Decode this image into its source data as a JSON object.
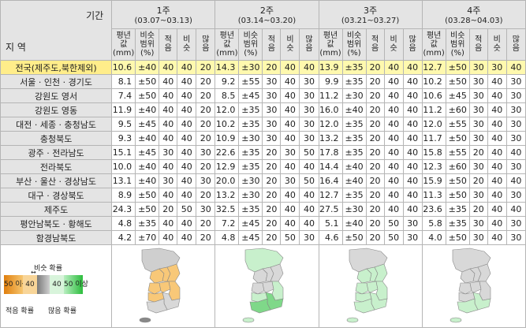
{
  "header": {
    "region_label": "지 역",
    "period_label": "기간"
  },
  "weeks": [
    {
      "title": "1주",
      "dates": "(03.07~03.13)"
    },
    {
      "title": "2주",
      "dates": "(03.14~03.20)"
    },
    {
      "title": "3주",
      "dates": "(03.21~03.27)"
    },
    {
      "title": "4주",
      "dates": "(03.28~04.03)"
    }
  ],
  "subheaders": {
    "avg": [
      "평년",
      "값",
      "(mm)"
    ],
    "range": [
      "비슷",
      "범위",
      "(%)"
    ],
    "low": [
      "적",
      "음"
    ],
    "similar": [
      "비",
      "슷"
    ],
    "high": [
      "많",
      "음"
    ]
  },
  "rows": [
    {
      "region": "전국(제주도,북한제외)",
      "w": [
        [
          "10.6",
          "±40",
          "40",
          "40",
          "20"
        ],
        [
          "14.3",
          "±30",
          "20",
          "40",
          "40"
        ],
        [
          "13.9",
          "±35",
          "20",
          "40",
          "40"
        ],
        [
          "12.7",
          "±50",
          "30",
          "30",
          "40"
        ]
      ]
    },
    {
      "region": "서울 · 인천 · 경기도",
      "w": [
        [
          "8.1",
          "±50",
          "40",
          "40",
          "20"
        ],
        [
          "9.2",
          "±55",
          "30",
          "40",
          "30"
        ],
        [
          "9.9",
          "±35",
          "20",
          "40",
          "40"
        ],
        [
          "10.2",
          "±50",
          "30",
          "40",
          "30"
        ]
      ]
    },
    {
      "region": "강원도 영서",
      "w": [
        [
          "7.4",
          "±50",
          "40",
          "40",
          "20"
        ],
        [
          "8.5",
          "±45",
          "30",
          "40",
          "30"
        ],
        [
          "11.2",
          "±30",
          "20",
          "40",
          "40"
        ],
        [
          "10.6",
          "±45",
          "30",
          "40",
          "30"
        ]
      ]
    },
    {
      "region": "강원도 영동",
      "w": [
        [
          "11.9",
          "±40",
          "40",
          "40",
          "20"
        ],
        [
          "12.0",
          "±35",
          "30",
          "40",
          "30"
        ],
        [
          "16.0",
          "±40",
          "20",
          "40",
          "40"
        ],
        [
          "11.2",
          "±60",
          "30",
          "40",
          "30"
        ]
      ]
    },
    {
      "region": "대전 · 세종 · 충청남도",
      "w": [
        [
          "9.5",
          "±45",
          "40",
          "40",
          "20"
        ],
        [
          "10.2",
          "±35",
          "30",
          "40",
          "30"
        ],
        [
          "12.0",
          "±35",
          "20",
          "40",
          "40"
        ],
        [
          "12.0",
          "±55",
          "30",
          "40",
          "30"
        ]
      ]
    },
    {
      "region": "충청북도",
      "w": [
        [
          "9.3",
          "±40",
          "40",
          "40",
          "20"
        ],
        [
          "10.9",
          "±30",
          "30",
          "40",
          "30"
        ],
        [
          "13.2",
          "±35",
          "20",
          "40",
          "40"
        ],
        [
          "11.7",
          "±50",
          "30",
          "40",
          "30"
        ]
      ]
    },
    {
      "region": "광주 · 전라남도",
      "w": [
        [
          "15.1",
          "±45",
          "30",
          "40",
          "30"
        ],
        [
          "22.6",
          "±35",
          "20",
          "30",
          "50"
        ],
        [
          "17.8",
          "±35",
          "20",
          "40",
          "40"
        ],
        [
          "15.8",
          "±55",
          "20",
          "40",
          "40"
        ]
      ]
    },
    {
      "region": "전라북도",
      "w": [
        [
          "10.0",
          "±40",
          "40",
          "40",
          "20"
        ],
        [
          "12.9",
          "±35",
          "20",
          "40",
          "40"
        ],
        [
          "14.4",
          "±40",
          "20",
          "40",
          "40"
        ],
        [
          "12.3",
          "±60",
          "30",
          "40",
          "30"
        ]
      ]
    },
    {
      "region": "부산 · 울산 · 경상남도",
      "w": [
        [
          "13.1",
          "±40",
          "30",
          "40",
          "30"
        ],
        [
          "20.0",
          "±30",
          "20",
          "30",
          "50"
        ],
        [
          "16.4",
          "±40",
          "20",
          "40",
          "40"
        ],
        [
          "15.9",
          "±50",
          "20",
          "40",
          "40"
        ]
      ]
    },
    {
      "region": "대구 · 경상북도",
      "w": [
        [
          "8.9",
          "±50",
          "40",
          "40",
          "20"
        ],
        [
          "13.2",
          "±30",
          "20",
          "40",
          "40"
        ],
        [
          "12.7",
          "±35",
          "20",
          "40",
          "40"
        ],
        [
          "11.3",
          "±50",
          "30",
          "40",
          "30"
        ]
      ]
    },
    {
      "region": "제주도",
      "w": [
        [
          "24.3",
          "±50",
          "20",
          "50",
          "30"
        ],
        [
          "32.5",
          "±35",
          "20",
          "40",
          "40"
        ],
        [
          "27.5",
          "±30",
          "20",
          "40",
          "40"
        ],
        [
          "23.6",
          "±35",
          "20",
          "40",
          "40"
        ]
      ]
    },
    {
      "region": "평안남북도 · 황해도",
      "w": [
        [
          "4.8",
          "±35",
          "40",
          "40",
          "20"
        ],
        [
          "7.2",
          "±45",
          "20",
          "40",
          "40"
        ],
        [
          "5.1",
          "±40",
          "20",
          "50",
          "30"
        ],
        [
          "5.8",
          "±35",
          "30",
          "40",
          "30"
        ]
      ]
    },
    {
      "region": "함경남북도",
      "w": [
        [
          "4.2",
          "±70",
          "40",
          "40",
          "20"
        ],
        [
          "4.8",
          "±45",
          "20",
          "50",
          "30"
        ],
        [
          "4.6",
          "±50",
          "20",
          "50",
          "30"
        ],
        [
          "4.0",
          "±50",
          "30",
          "40",
          "30"
        ]
      ]
    }
  ],
  "legend": {
    "similar_prob": "비슷 확률",
    "low_prob": "적음 확률",
    "high_prob": "많음 확률",
    "scale": [
      "50 이상",
      "40",
      "40",
      "50 이상"
    ],
    "colors": {
      "low_strong": "#e99a1e",
      "low": "#f6c56f",
      "neutral": "#9a9a9a",
      "high": "#b8eec0",
      "high_strong": "#2bbd3c"
    }
  },
  "maps": [
    {
      "week": "1주",
      "regions_fill": {
        "north": "#cfcfcf",
        "gyeonggi": "#f8c878",
        "gangwon_w": "#f8c878",
        "gangwon_e": "#f8c878",
        "chungnam": "#f8c878",
        "chungbuk": "#f8c878",
        "jeonbuk": "#f8c878",
        "jeonnam": "#d8d8d8",
        "gyeongbuk": "#f8c878",
        "gyeongnam": "#d8d8d8",
        "jeju": "#888888"
      }
    },
    {
      "week": "2주",
      "regions_fill": {
        "north": "#c8f0cc",
        "gyeonggi": "#d8d8d8",
        "gangwon_w": "#d8d8d8",
        "gangwon_e": "#d8d8d8",
        "chungnam": "#d8d8d8",
        "chungbuk": "#d8d8d8",
        "jeonbuk": "#c8f0cc",
        "jeonnam": "#7fd889",
        "gyeongbuk": "#c8f0cc",
        "gyeongnam": "#7fd889",
        "jeju": "#c8f0cc"
      }
    },
    {
      "week": "3주",
      "regions_fill": {
        "north": "#d8d8d8",
        "gyeonggi": "#c8f0cc",
        "gangwon_w": "#c8f0cc",
        "gangwon_e": "#c8f0cc",
        "chungnam": "#c8f0cc",
        "chungbuk": "#c8f0cc",
        "jeonbuk": "#c8f0cc",
        "jeonnam": "#c8f0cc",
        "gyeongbuk": "#c8f0cc",
        "gyeongnam": "#c8f0cc",
        "jeju": "#c8f0cc"
      }
    },
    {
      "week": "4주",
      "regions_fill": {
        "north": "#d8d8d8",
        "gyeonggi": "#d8d8d8",
        "gangwon_w": "#d8d8d8",
        "gangwon_e": "#d8d8d8",
        "chungnam": "#d8d8d8",
        "chungbuk": "#d8d8d8",
        "jeonbuk": "#d8d8d8",
        "jeonnam": "#c8f0cc",
        "gyeongbuk": "#d8d8d8",
        "gyeongnam": "#c8f0cc",
        "jeju": "#c8f0cc"
      }
    }
  ]
}
